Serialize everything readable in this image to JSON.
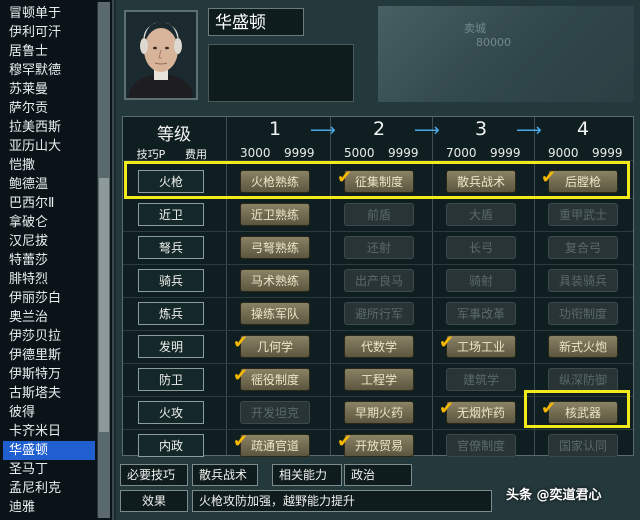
{
  "leftlist": [
    "冒顿单于",
    "伊利可汗",
    "居鲁士",
    "穆罕默德",
    "苏莱曼",
    "萨尔贡",
    "拉美西斯",
    "亚历山大",
    "恺撒",
    "鲍德温",
    "巴西尔Ⅱ",
    "拿破仑",
    "汉尼拔",
    "特蕾莎",
    "腓特烈",
    "伊丽莎白",
    "奥兰治",
    "伊莎贝拉",
    "伊德里斯",
    "伊斯特万",
    "古斯塔夫",
    "彼得",
    "卡齐米日",
    "华盛顿",
    "圣马丁",
    "孟尼利克",
    "迪雅"
  ],
  "selected_index": 23,
  "leader_name": "华盛顿",
  "map_labels": {
    "city": "卖城",
    "num": "80000"
  },
  "header": {
    "level": "等级",
    "cols": [
      "1",
      "2",
      "3",
      "4"
    ],
    "sub_left": "技巧P",
    "sub_right": "费用"
  },
  "costs": [
    [
      "3000",
      "9999"
    ],
    [
      "5000",
      "9999"
    ],
    [
      "7000",
      "9999"
    ],
    [
      "9000",
      "9999"
    ]
  ],
  "rows": [
    {
      "label": "火枪",
      "cells": [
        {
          "t": "火枪熟练",
          "on": true,
          "ck": false
        },
        {
          "t": "征集制度",
          "on": true,
          "ck": true
        },
        {
          "t": "散兵战术",
          "on": true,
          "ck": false
        },
        {
          "t": "后膛枪",
          "on": true,
          "ck": true
        }
      ]
    },
    {
      "label": "近卫",
      "cells": [
        {
          "t": "近卫熟练",
          "on": true,
          "ck": false
        },
        {
          "t": "前盾",
          "on": false,
          "ck": false
        },
        {
          "t": "大盾",
          "on": false,
          "ck": false
        },
        {
          "t": "重甲武士",
          "on": false,
          "ck": false
        }
      ]
    },
    {
      "label": "弩兵",
      "cells": [
        {
          "t": "弓弩熟练",
          "on": true,
          "ck": false
        },
        {
          "t": "还射",
          "on": false,
          "ck": false
        },
        {
          "t": "长弓",
          "on": false,
          "ck": false
        },
        {
          "t": "复合弓",
          "on": false,
          "ck": false
        }
      ]
    },
    {
      "label": "骑兵",
      "cells": [
        {
          "t": "马术熟练",
          "on": true,
          "ck": false
        },
        {
          "t": "出产良马",
          "on": false,
          "ck": false
        },
        {
          "t": "骑射",
          "on": false,
          "ck": false
        },
        {
          "t": "具装骑兵",
          "on": false,
          "ck": false
        }
      ]
    },
    {
      "label": "炼兵",
      "cells": [
        {
          "t": "操练军队",
          "on": true,
          "ck": false
        },
        {
          "t": "避所行军",
          "on": false,
          "ck": false
        },
        {
          "t": "军事改革",
          "on": false,
          "ck": false
        },
        {
          "t": "功衔制度",
          "on": false,
          "ck": false
        }
      ]
    },
    {
      "label": "发明",
      "cells": [
        {
          "t": "几何学",
          "on": true,
          "ck": true
        },
        {
          "t": "代数学",
          "on": true,
          "ck": false
        },
        {
          "t": "工场工业",
          "on": true,
          "ck": true
        },
        {
          "t": "新式火炮",
          "on": true,
          "ck": false
        }
      ]
    },
    {
      "label": "防卫",
      "cells": [
        {
          "t": "徭役制度",
          "on": true,
          "ck": true
        },
        {
          "t": "工程学",
          "on": true,
          "ck": false
        },
        {
          "t": "建筑学",
          "on": false,
          "ck": false
        },
        {
          "t": "纵深防御",
          "on": false,
          "ck": false
        }
      ]
    },
    {
      "label": "火攻",
      "cells": [
        {
          "t": "开发坦克",
          "on": false,
          "ck": false
        },
        {
          "t": "早期火药",
          "on": true,
          "ck": false
        },
        {
          "t": "无烟炸药",
          "on": true,
          "ck": true
        },
        {
          "t": "核武器",
          "on": true,
          "ck": true
        }
      ]
    },
    {
      "label": "内政",
      "cells": [
        {
          "t": "疏通官道",
          "on": true,
          "ck": true
        },
        {
          "t": "开放贸易",
          "on": true,
          "ck": true
        },
        {
          "t": "官僚制度",
          "on": false,
          "ck": false
        },
        {
          "t": "国家认同",
          "on": false,
          "ck": false
        }
      ]
    }
  ],
  "bottom": {
    "req_label": "必要技巧",
    "req_value": "散兵战术",
    "abil_label": "相关能力",
    "abil_value": "政治",
    "effect_label": "效果",
    "effect_value": "火枪攻防加强，越野能力提升"
  },
  "watermark": "头条 @奕道君心"
}
